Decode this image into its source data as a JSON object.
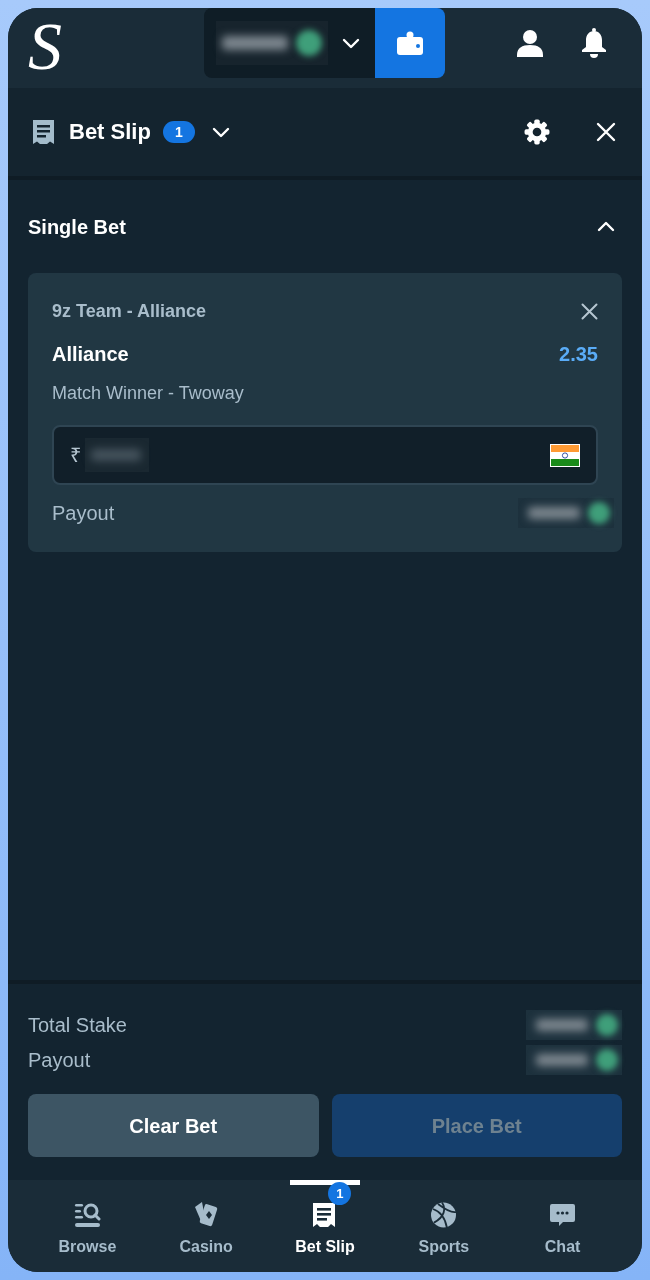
{
  "top_bar": {
    "logo": "S"
  },
  "bet_slip_header": {
    "title": "Bet Slip",
    "count": "1"
  },
  "single_bet": {
    "title": "Single Bet",
    "expanded": true,
    "bets": [
      {
        "event": "9z Team - Alliance",
        "selection": "Alliance",
        "odds": "2.35",
        "market": "Match Winner - Twoway",
        "stake_currency": "₹",
        "payout_label": "Payout"
      }
    ]
  },
  "summary": {
    "rows": [
      {
        "label": "Total Stake"
      },
      {
        "label": "Payout"
      }
    ],
    "buttons": [
      {
        "label": "Clear Bet",
        "kind": "secondary",
        "disabled": false
      },
      {
        "label": "Place Bet",
        "kind": "primary",
        "disabled": true
      }
    ]
  },
  "bottom_nav": [
    {
      "label": "Browse",
      "selected": false
    },
    {
      "label": "Casino",
      "selected": false
    },
    {
      "label": "Bet Slip",
      "selected": true,
      "badge": "1"
    },
    {
      "label": "Sports",
      "selected": false
    },
    {
      "label": "Chat",
      "selected": false
    }
  ]
}
